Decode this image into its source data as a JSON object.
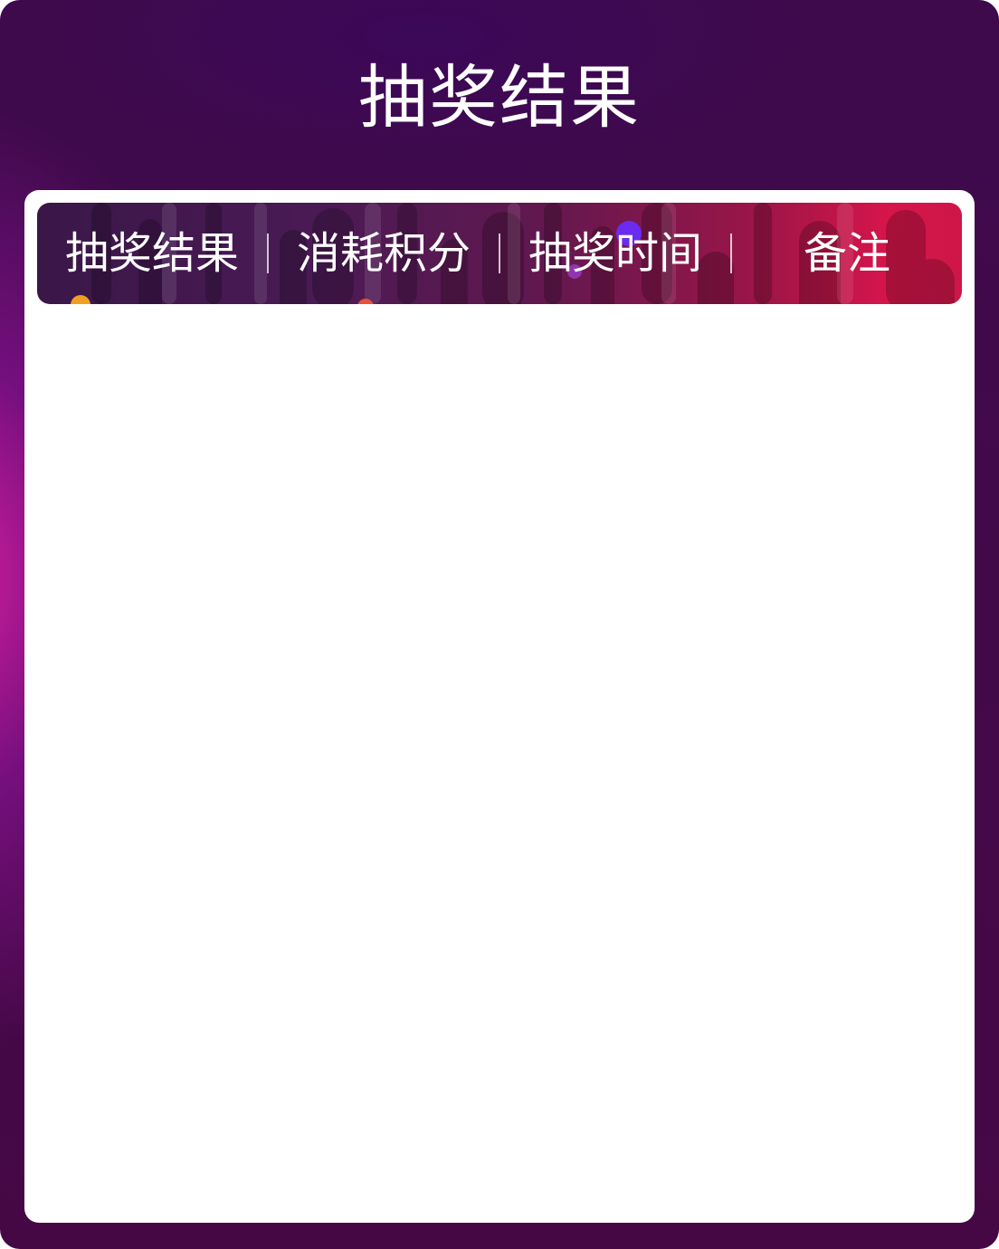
{
  "page": {
    "title": "抽奖结果"
  },
  "table": {
    "columns": [
      {
        "label": "抽奖结果"
      },
      {
        "label": "消耗积分"
      },
      {
        "label": "抽奖时间"
      },
      {
        "label": "备注"
      }
    ],
    "rows": []
  },
  "colors": {
    "background": "#420a4a",
    "accent_magenta": "#d61ea0",
    "header_start": "#3a1748",
    "header_end": "#d6154a",
    "panel": "#ffffff",
    "text_light": "#ffffff"
  }
}
